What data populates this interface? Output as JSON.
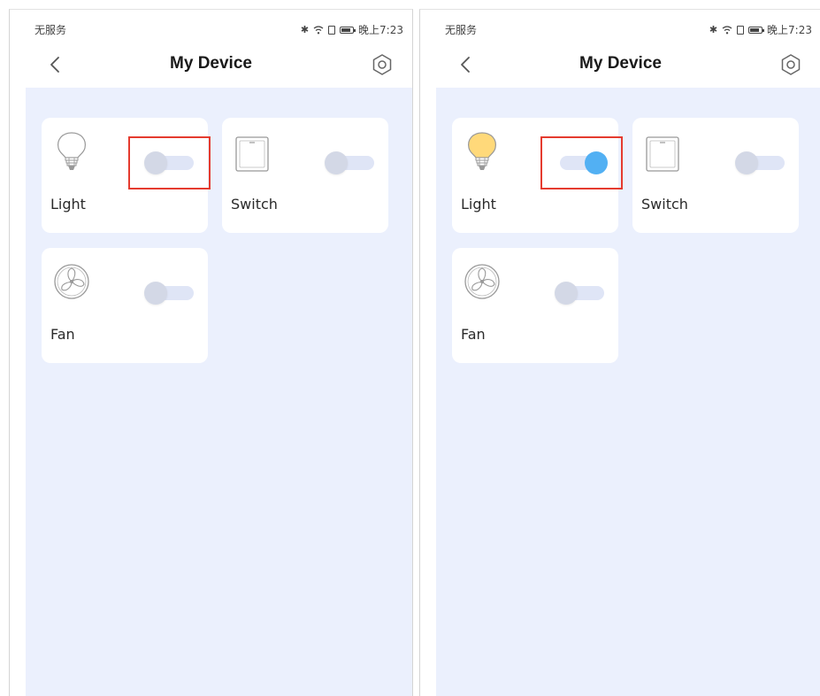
{
  "colors": {
    "accent": "#52b0f3",
    "page_background": "#ebf0fd",
    "highlight": "#e53b2f"
  },
  "screens": [
    {
      "status_bar": {
        "carrier": "无服务",
        "time": "晚上7:23"
      },
      "nav": {
        "title": "My Device",
        "back_icon": "chevron-left-icon",
        "settings_icon": "gear-icon"
      },
      "devices": [
        {
          "name": "Light",
          "icon": "light-bulb-icon",
          "on": false
        },
        {
          "name": "Switch",
          "icon": "wall-switch-icon",
          "on": false
        },
        {
          "name": "Fan",
          "icon": "fan-icon",
          "on": false
        }
      ]
    },
    {
      "status_bar": {
        "carrier": "无服务",
        "time": "晚上7:23"
      },
      "nav": {
        "title": "My Device",
        "back_icon": "chevron-left-icon",
        "settings_icon": "gear-icon"
      },
      "devices": [
        {
          "name": "Light",
          "icon": "light-bulb-icon",
          "on": true
        },
        {
          "name": "Switch",
          "icon": "wall-switch-icon",
          "on": false
        },
        {
          "name": "Fan",
          "icon": "fan-icon",
          "on": false
        }
      ]
    }
  ]
}
